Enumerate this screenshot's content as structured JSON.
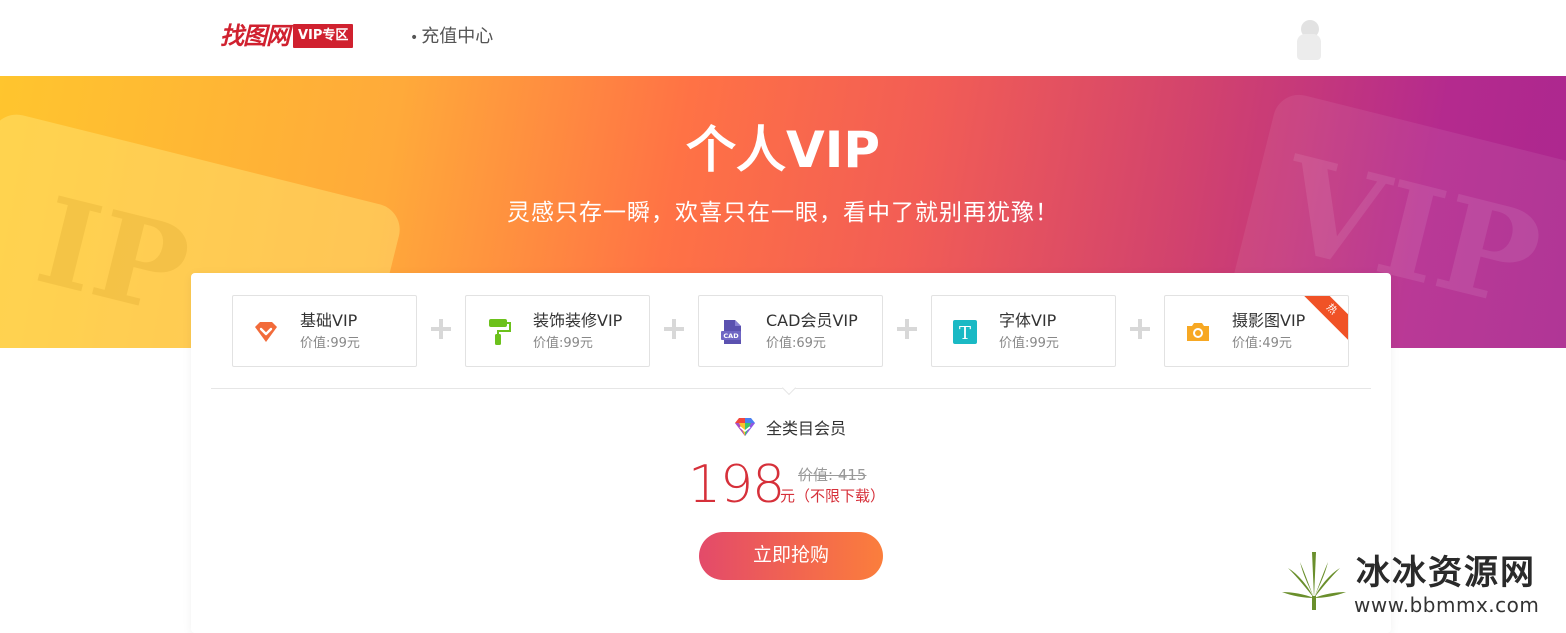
{
  "header": {
    "logo_text": "找图网",
    "logo_badge": "VIP专区",
    "current_nav": "充值中心",
    "nav_bullet": "•"
  },
  "banner": {
    "title": "个人VIP",
    "subtitle": "灵感只存一瞬，欢喜只在一眼，看中了就别再犹豫！"
  },
  "packages": [
    {
      "name": "基础VIP",
      "value": "价值:99元",
      "icon": "diamond-icon",
      "color": "#f26b3a"
    },
    {
      "name": "装饰装修VIP",
      "value": "价值:99元",
      "icon": "paint-roller-icon",
      "color": "#6cc11c"
    },
    {
      "name": "CAD会员VIP",
      "value": "价值:69元",
      "icon": "cad-file-icon",
      "color": "#5b51b0"
    },
    {
      "name": "字体VIP",
      "value": "价值:99元",
      "icon": "font-t-icon",
      "color": "#1ab9c4"
    },
    {
      "name": "摄影图VIP",
      "value": "价值:49元",
      "icon": "camera-icon",
      "color": "#f7a823",
      "ribbon": "热"
    }
  ],
  "summary": {
    "all_category_label": "全类目会员",
    "price": "198",
    "original_price": "价值: 415",
    "unit": "元（不限下载）",
    "buy_label": "立即抢购"
  },
  "watermark": {
    "name": "冰冰资源网",
    "url": "www.bbmmx.com"
  },
  "colors": {
    "brand_red": "#d0212f",
    "price_red": "#d6303a",
    "banner_start": "#ffc52e",
    "banner_end": "#ab278f"
  }
}
